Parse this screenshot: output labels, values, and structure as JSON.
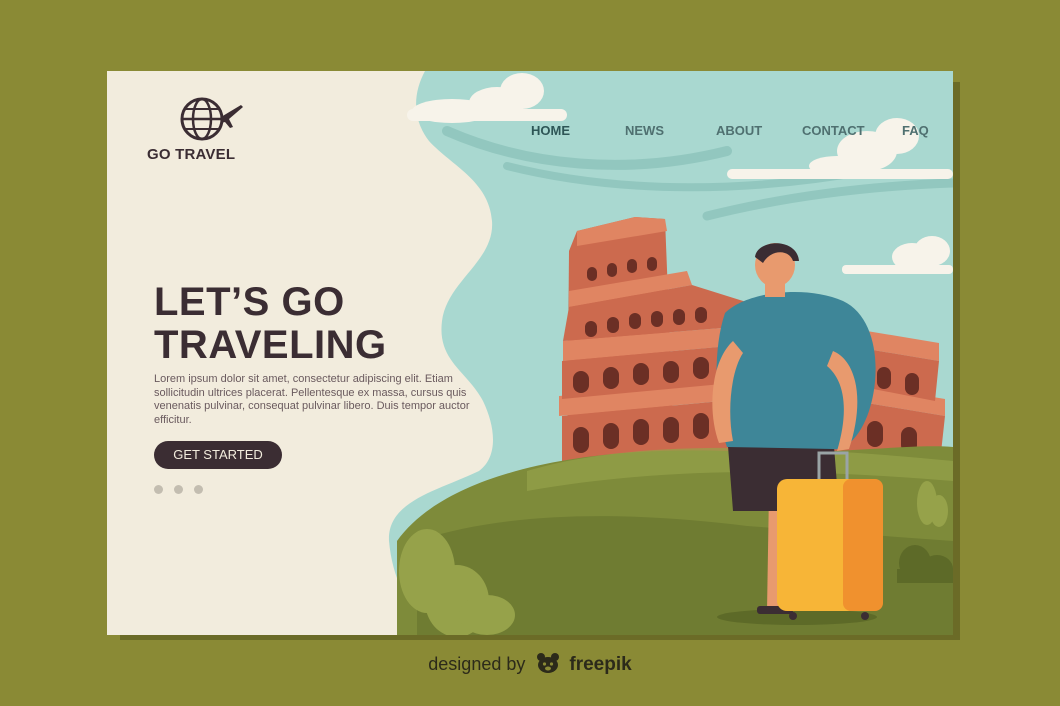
{
  "brand": {
    "name": "GO TRAVEL"
  },
  "nav": {
    "items": [
      {
        "label": "HOME",
        "active": true
      },
      {
        "label": "NEWS",
        "active": false
      },
      {
        "label": "ABOUT",
        "active": false
      },
      {
        "label": "CONTACT",
        "active": false
      },
      {
        "label": "FAQ",
        "active": false
      }
    ]
  },
  "hero": {
    "headline_line1": "LET’S GO",
    "headline_line2": "TRAVELING",
    "body": "Lorem ipsum dolor sit amet, consectetur adipiscing elit. Etiam sollicitudin ultrices placerat. Pellentesque ex massa, cursus quis venenatis pulvinar, consequat pulvinar libero. Duis tempor auctor efficitur.",
    "cta_label": "GET STARTED",
    "carousel_dots": 3
  },
  "illustration": {
    "subject": "traveler-with-suitcase-icon",
    "landmark": "colosseum-icon"
  },
  "credit": {
    "prefix": "designed by",
    "brand": "freepik"
  },
  "colors": {
    "background": "#8a8a35",
    "card": "#f2ecdd",
    "sky": "#a9d8d0",
    "dark": "#3b2d33",
    "nav": "#4f7070",
    "colosseum": "#cc6a4e",
    "shirt": "#3e8698",
    "suitcase": "#f7b537",
    "grass": "#7e8b3a"
  }
}
